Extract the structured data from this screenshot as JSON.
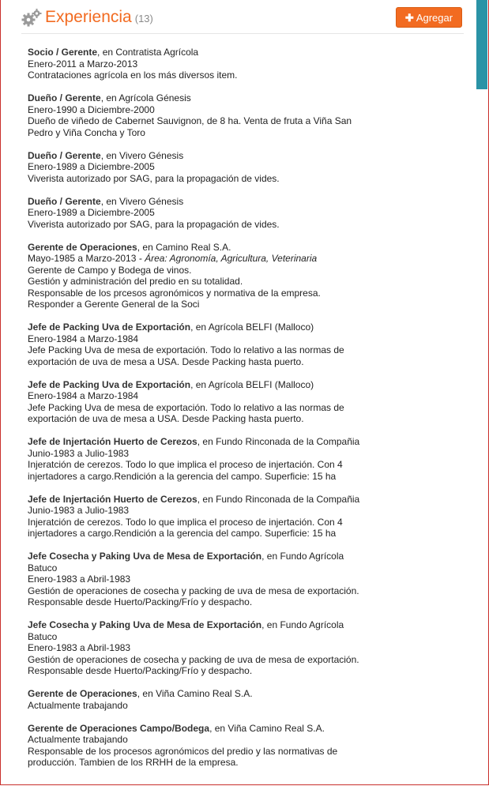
{
  "section": {
    "title": "Experiencia",
    "count": "(13)",
    "add_label": "Agregar",
    "accent": "#f26b21"
  },
  "entries": [
    {
      "role": "Socio / Gerente",
      "company": ", en Contratista Agrícola",
      "dates": "Enero-2011 a Marzo-2013",
      "area": "",
      "desc": "Contrataciones agrícola en los más diversos item."
    },
    {
      "role": "Dueño / Gerente",
      "company": ", en Agrícola Génesis",
      "dates": "Enero-1990 a Diciembre-2000",
      "area": "",
      "desc": "Dueño de viñedo de Cabernet Sauvignon, de 8 ha. Venta de fruta a Viña San\nPedro y Viña Concha y Toro"
    },
    {
      "role": "Dueño / Gerente",
      "company": ", en Vivero Génesis",
      "dates": "Enero-1989 a Diciembre-2005",
      "area": "",
      "desc": "Viverista autorizado por SAG, para la propagación de vides."
    },
    {
      "role": "Dueño / Gerente",
      "company": ", en Vivero Génesis",
      "dates": "Enero-1989 a Diciembre-2005",
      "area": "",
      "desc": "Viverista autorizado por SAG, para la propagación de vides."
    },
    {
      "role": "Gerente de Operaciones",
      "company": ", en Camino Real S.A.",
      "dates": "Mayo-1985 a Marzo-2013",
      "area": " - Área: Agronomía, Agricultura, Veterinaria",
      "desc": "Gerente de Campo y Bodega de vinos.\nGestión y administración del predio en su totalidad.\nResponsable de los prcesos agronómicos y normativa de la empresa.\nResponder a Gerente General de la Soci"
    },
    {
      "role": "Jefe de Packing Uva de Exportación",
      "company": ", en Agrícola BELFI (Malloco)",
      "dates": "Enero-1984 a Marzo-1984",
      "area": "",
      "desc": "Jefe Packing Uva de mesa de exportación. Todo lo relativo a las normas de\nexportación de uva de mesa a USA. Desde Packing hasta puerto."
    },
    {
      "role": "Jefe de Packing Uva de Exportación",
      "company": ", en Agrícola BELFI (Malloco)",
      "dates": "Enero-1984 a Marzo-1984",
      "area": "",
      "desc": "Jefe Packing Uva de mesa de exportación. Todo lo relativo a las normas de\nexportación de uva de mesa a USA. Desde Packing hasta puerto."
    },
    {
      "role": "Jefe de Injertación Huerto de Cerezos",
      "company": ", en Fundo Rinconada de la Compañia",
      "dates": "Junio-1983 a Julio-1983",
      "area": "",
      "desc": "Injeratción de cerezos. Todo lo que implica el proceso de injertación. Con 4\ninjertadores a cargo.Rendición a la gerencia del campo. Superficie: 15 ha"
    },
    {
      "role": "Jefe de Injertación Huerto de Cerezos",
      "company": ", en Fundo Rinconada de la Compañia",
      "dates": "Junio-1983 a Julio-1983",
      "area": "",
      "desc": "Injeratción de cerezos. Todo lo que implica el proceso de injertación. Con 4\ninjertadores a cargo.Rendición a la gerencia del campo. Superficie: 15 ha"
    },
    {
      "role": "Jefe Cosecha y Paking Uva de Mesa de Exportación",
      "company": ", en Fundo Agrícola\nBatuco",
      "dates": "Enero-1983 a Abril-1983",
      "area": "",
      "desc": "Gestión de operaciones de cosecha y packing de uva de mesa de exportación.\nResponsable desde Huerto/Packing/Frío y despacho."
    },
    {
      "role": "Jefe Cosecha y Paking Uva de Mesa de Exportación",
      "company": ", en Fundo Agrícola\nBatuco",
      "dates": "Enero-1983 a Abril-1983",
      "area": "",
      "desc": "Gestión de operaciones de cosecha y packing de uva de mesa de exportación.\nResponsable desde Huerto/Packing/Frío y despacho."
    },
    {
      "role": "Gerente de Operaciones",
      "company": ", en Viña Camino Real S.A.",
      "dates": "Actualmente trabajando",
      "area": "",
      "desc": ""
    },
    {
      "role": "Gerente de Operaciones Campo/Bodega",
      "company": ", en Viña Camino Real S.A.",
      "dates": "Actualmente trabajando",
      "area": "",
      "desc": "Responsable de los procesos agronómicos del predio y las normativas de\nproducción. Tambien de los RRHH de la empresa."
    }
  ]
}
